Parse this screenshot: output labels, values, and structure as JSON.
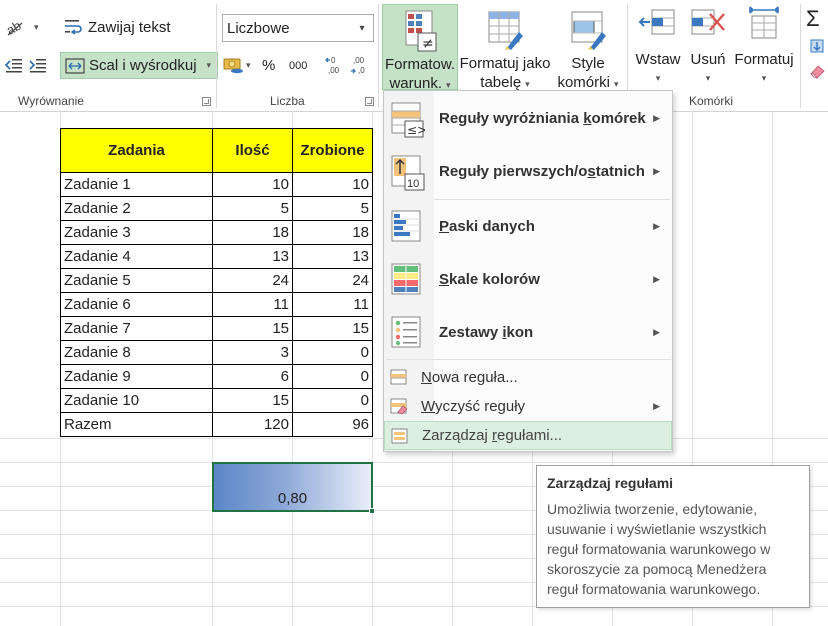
{
  "ribbon": {
    "wrap_text": "Zawijaj tekst",
    "merge_center": "Scal i wyśrodkuj",
    "number_format": "Liczbowe",
    "percent": "%",
    "thousands": "000",
    "conditional_formatting": [
      "Formatow.",
      "warunk."
    ],
    "format_as_table": [
      "Formatuj jako",
      "tabelę"
    ],
    "cell_styles": [
      "Style",
      "komórki"
    ],
    "insert": "Wstaw",
    "delete": "Usuń",
    "format": "Formatuj",
    "sigma": "Σ",
    "groups": {
      "alignment": "Wyrównanie",
      "number": "Liczba",
      "cells": "Komórki"
    }
  },
  "sheet": {
    "headers": [
      "Zadania",
      "Ilość",
      "Zrobione"
    ],
    "rows": [
      [
        "Zadanie 1",
        "10",
        "10"
      ],
      [
        "Zadanie 2",
        "5",
        "5"
      ],
      [
        "Zadanie 3",
        "18",
        "18"
      ],
      [
        "Zadanie 4",
        "13",
        "13"
      ],
      [
        "Zadanie 5",
        "24",
        "24"
      ],
      [
        "Zadanie 6",
        "11",
        "11"
      ],
      [
        "Zadanie 7",
        "15",
        "15"
      ],
      [
        "Zadanie 8",
        "3",
        "0"
      ],
      [
        "Zadanie 9",
        "6",
        "0"
      ],
      [
        "Zadanie 10",
        "15",
        "0"
      ],
      [
        "Razem",
        "120",
        "96"
      ]
    ],
    "ratio": "0,80",
    "ratio_value": 0.8
  },
  "menu": {
    "items": [
      {
        "pre": "Reguły wyróżniania ",
        "key": "k",
        "post": "omórek",
        "has_submenu": true,
        "icon": "highlight-cells-icon"
      },
      {
        "pre": "Reguły pierwszych/o",
        "key": "s",
        "post": "tatnich",
        "has_submenu": true,
        "icon": "top-bottom-icon"
      },
      {
        "pre": "",
        "key": "P",
        "post": "aski danych",
        "has_submenu": true,
        "icon": "data-bars-icon"
      },
      {
        "pre": "",
        "key": "S",
        "post": "kale kolorów",
        "has_submenu": true,
        "icon": "color-scales-icon"
      },
      {
        "pre": "Zestawy ",
        "key": "i",
        "post": "kon",
        "has_submenu": true,
        "icon": "icon-sets-icon"
      },
      {
        "pre": "",
        "key": "N",
        "post": "owa reguła...",
        "has_submenu": false,
        "icon": "new-rule-icon"
      },
      {
        "pre": "",
        "key": "W",
        "post": "yczyść reguły",
        "has_submenu": true,
        "icon": "clear-rules-icon"
      },
      {
        "pre": "Zarządzaj ",
        "key": "r",
        "post": "egułami...",
        "has_submenu": false,
        "icon": "manage-rules-icon"
      }
    ]
  },
  "tooltip": {
    "title": "Zarządzaj regułami",
    "lines": [
      "Umożliwia tworzenie, edytowanie,",
      "usuwanie i wyświetlanie wszystkich",
      "reguł formatowania warunkowego w",
      "skoroszycie za pomocą Menedżera",
      "reguł formatowania warunkowego."
    ]
  },
  "colors": {
    "accent_green": "#217346",
    "header_fill": "#ffff00",
    "hover_fill": "#dcefe0",
    "gradient_start": "#5b87c7",
    "gradient_end": "#e9eef8"
  }
}
